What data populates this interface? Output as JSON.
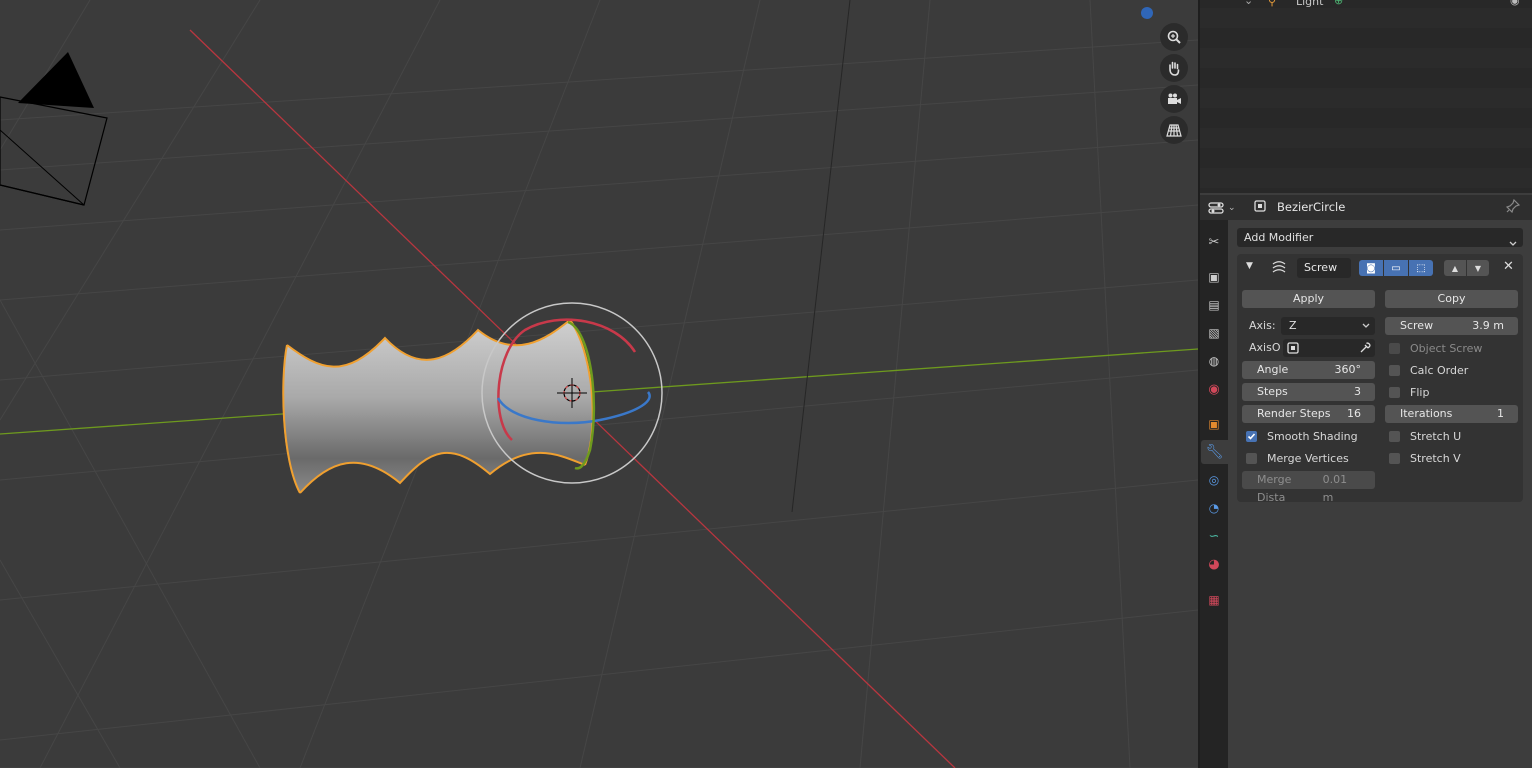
{
  "outliner": {
    "partial_row_label": "Light"
  },
  "properties": {
    "object_name": "BezierCircle",
    "add_modifier": "Add Modifier",
    "modifier": {
      "name": "Screw",
      "apply": "Apply",
      "copy": "Copy",
      "axis_label": "Axis:",
      "axis_value": "Z",
      "axis_object_label": "AxisO",
      "screw": {
        "label": "Screw",
        "value": "3.9 m"
      },
      "object_screw": "Object Screw",
      "angle": {
        "label": "Angle",
        "value": "360°"
      },
      "calc_order": "Calc Order",
      "steps": {
        "label": "Steps",
        "value": "3"
      },
      "flip": "Flip",
      "render_steps": {
        "label": "Render Steps",
        "value": "16"
      },
      "iterations": {
        "label": "Iterations",
        "value": "1"
      },
      "smooth_shading": {
        "label": "Smooth Shading",
        "checked": true
      },
      "stretch_u": {
        "label": "Stretch U",
        "checked": false
      },
      "merge_vertices": {
        "label": "Merge Vertices",
        "checked": false
      },
      "stretch_v": {
        "label": "Stretch V",
        "checked": false
      },
      "merge_distance": {
        "label": "Merge Dista",
        "value": "0.01 m"
      },
      "object_screw_checked": false,
      "calc_order_checked": false,
      "flip_checked": false
    }
  },
  "colors": {
    "accent": "#4772b3",
    "selection_outline": "#f0a030",
    "x_axis": "#c8394a",
    "y_axis": "#6e9a1e",
    "z_axis": "#3a78c9"
  },
  "icons": {
    "viewport_nav": [
      "zoom-icon",
      "hand-pan-icon",
      "camera-view-icon",
      "grid-perspective-icon"
    ],
    "tabs": [
      "tool-icon",
      "render-icon",
      "output-icon",
      "view-layer-icon",
      "scene-icon",
      "world-icon",
      "object-icon",
      "modifier-icon",
      "particles-icon",
      "physics-icon",
      "constraints-icon",
      "data-curve-icon",
      "material-icon",
      "texture-icon"
    ]
  }
}
